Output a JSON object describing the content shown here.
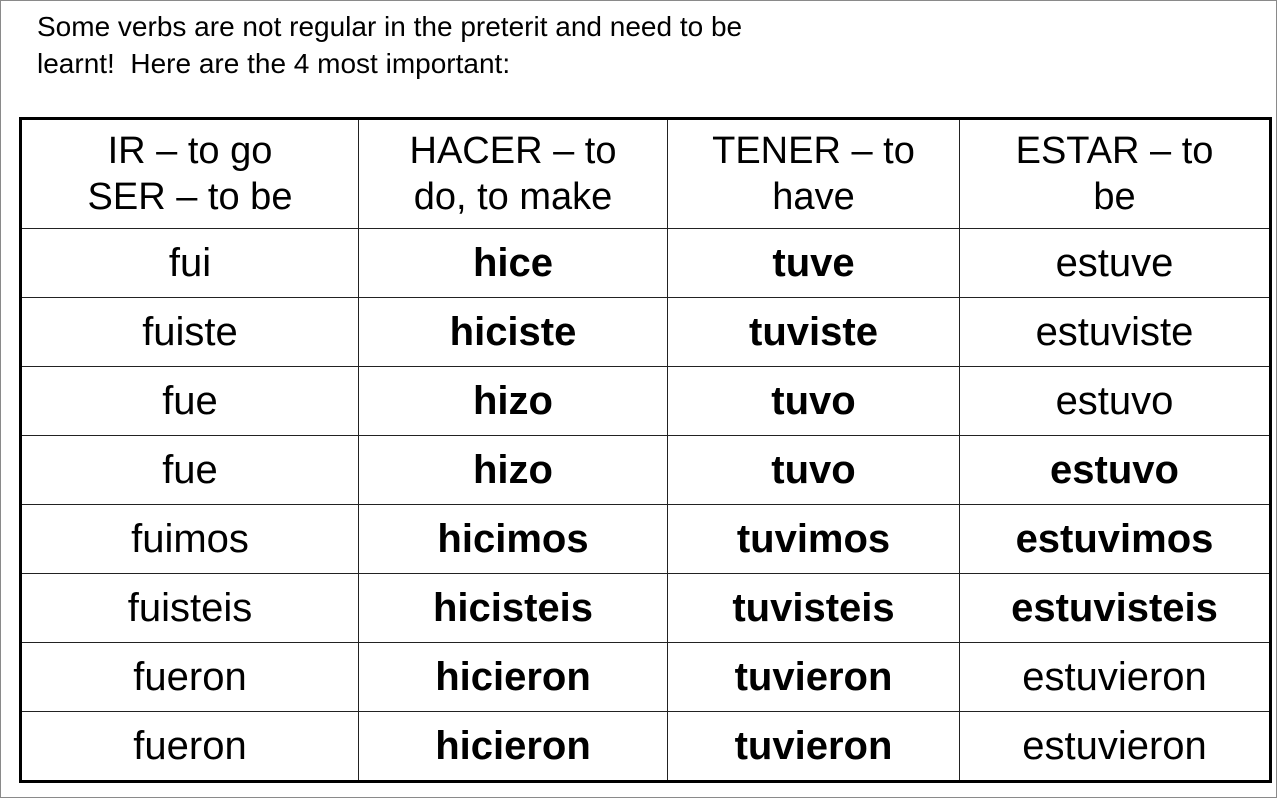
{
  "intro": {
    "line1": "Some verbs are not regular in the preterit and need to be",
    "line2": "learnt!  Here are the 4 most important:"
  },
  "table": {
    "headers": [
      {
        "line1": "IR – to go",
        "line2": "SER – to be"
      },
      {
        "line1": "HACER – to",
        "line2": "do, to make"
      },
      {
        "line1": "TENER – to",
        "line2": "have"
      },
      {
        "line1": "ESTAR – to",
        "line2": "be"
      }
    ],
    "rows": [
      [
        {
          "t": "fui",
          "b": false
        },
        {
          "t": "hice",
          "b": true
        },
        {
          "t": "tuve",
          "b": true
        },
        {
          "t": "estuve",
          "b": false
        }
      ],
      [
        {
          "t": "fuiste",
          "b": false
        },
        {
          "t": "hiciste",
          "b": true
        },
        {
          "t": "tuviste",
          "b": true
        },
        {
          "t": "estuviste",
          "b": false
        }
      ],
      [
        {
          "t": "fue",
          "b": false
        },
        {
          "t": "hizo",
          "b": true
        },
        {
          "t": "tuvo",
          "b": true
        },
        {
          "t": "estuvo",
          "b": false
        }
      ],
      [
        {
          "t": "fue",
          "b": false
        },
        {
          "t": "hizo",
          "b": true
        },
        {
          "t": "tuvo",
          "b": true
        },
        {
          "t": "estuvo",
          "b": true
        }
      ],
      [
        {
          "t": "fuimos",
          "b": false
        },
        {
          "t": "hicimos",
          "b": true
        },
        {
          "t": "tuvimos",
          "b": true
        },
        {
          "t": "estuvimos",
          "b": true
        }
      ],
      [
        {
          "t": "fuisteis",
          "b": false
        },
        {
          "t": "hicisteis",
          "b": true
        },
        {
          "t": "tuvisteis",
          "b": true
        },
        {
          "t": "estuvisteis",
          "b": true
        }
      ],
      [
        {
          "t": "fueron",
          "b": false
        },
        {
          "t": "hicieron",
          "b": true
        },
        {
          "t": "tuvieron",
          "b": true
        },
        {
          "t": "estuvieron",
          "b": false
        }
      ],
      [
        {
          "t": "fueron",
          "b": false
        },
        {
          "t": "hicieron",
          "b": true
        },
        {
          "t": "tuvieron",
          "b": true
        },
        {
          "t": "estuvieron",
          "b": false
        }
      ]
    ]
  }
}
